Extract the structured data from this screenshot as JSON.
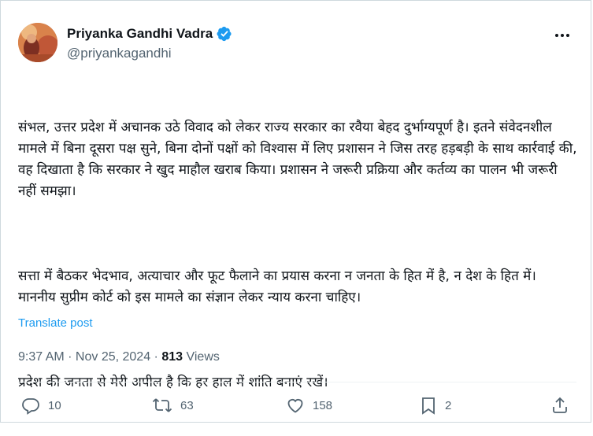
{
  "author": {
    "display_name": "Priyanka Gandhi Vadra",
    "handle": "@priyankagandhi",
    "verified": true
  },
  "tweet": {
    "paragraphs": [
      "संभल, उत्तर प्रदेश में अचानक उठे विवाद को लेकर राज्य सरकार का रवैया बेहद दुर्भाग्यपूर्ण है। इतने संवेदनशील मामले में बिना दूसरा पक्ष सुने, बिना दोनों पक्षों को विश्वास में लिए प्रशासन ने जिस तरह हड़बड़ी के साथ कार्रवाई की, वह दिखाता है कि सरकार ने खुद माहौल खराब किया। प्रशासन ने जरूरी प्रक्रिया और कर्तव्य का पालन भी जरूरी नहीं समझा।",
      "सत्ता में बैठकर भेदभाव, अत्याचार और फूट फैलाने का प्रयास करना न जनता के हित में है, न देश के हित में। माननीय सुप्रीम कोर्ट को इस मामले का संज्ञान लेकर न्याय करना चाहिए।",
      "प्रदेश की जनता से मेरी अपील है कि हर हाल में शांति बनाएं रखें।"
    ],
    "translate_label": "Translate post",
    "timestamp": "9:37 AM · Nov 25, 2024 · ",
    "views_count": "813",
    "views_label": " Views"
  },
  "actions": {
    "replies": "10",
    "reposts": "63",
    "likes": "158",
    "bookmarks": "2"
  },
  "colors": {
    "accent": "#1d9bf0",
    "secondary_text": "#536471",
    "primary_text": "#0f1419"
  },
  "icons": [
    "verified-badge-icon",
    "more-icon",
    "reply-icon",
    "repost-icon",
    "like-icon",
    "bookmark-icon",
    "share-icon"
  ]
}
